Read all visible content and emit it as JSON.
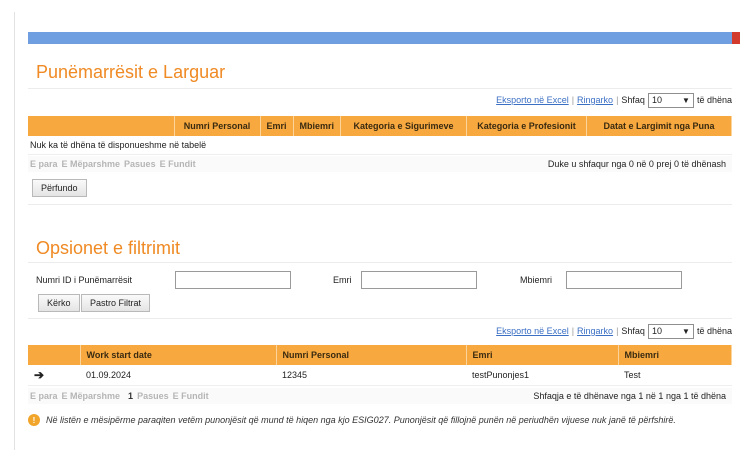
{
  "section1": {
    "title": "Punëmarrësit e Larguar",
    "toolbar": {
      "export": "Eksporto në Excel",
      "refresh": "Ringarko",
      "show": "Shfaq",
      "page_size": "10",
      "unit": "të dhëna"
    },
    "columns": [
      "",
      "Numri Personal",
      "Emri",
      "Mbiemri",
      "Kategoria e Sigurimeve",
      "Kategoria e Profesionit",
      "Datat e Largimit nga Puna"
    ],
    "empty_message": "Nuk ka të dhëna të disponueshme në tabelë",
    "pager": {
      "first": "E para",
      "prev": "E Mëparshme",
      "next": "Pasues",
      "last": "E Fundit",
      "info": "Duke u shfaqur nga 0 në 0 prej 0 të dhënash"
    },
    "finish_button": "Përfundo"
  },
  "section2": {
    "title": "Opsionet e filtrimit",
    "fields": {
      "id_label": "Numri ID i Punëmarrësit",
      "name_label": "Emri",
      "surname_label": "Mbiemri",
      "id_value": "",
      "name_value": "",
      "surname_value": ""
    },
    "search_button": "Kërko",
    "clear_button": "Pastro Filtrat",
    "toolbar": {
      "export": "Eksporto në Excel",
      "refresh": "Ringarko",
      "show": "Shfaq",
      "page_size": "10",
      "unit": "të dhëna"
    },
    "columns": [
      "",
      "Work start date",
      "Numri Personal",
      "Emri",
      "Mbiemri"
    ],
    "rows": [
      {
        "arrow": "➔",
        "date": "01.09.2024",
        "personal": "12345",
        "name": "testPunonjes1",
        "surname": "Test"
      }
    ],
    "pager": {
      "first": "E para",
      "prev": "E Mëparshme",
      "current": "1",
      "next": "Pasues",
      "last": "E Fundit",
      "info": "Shfaqja e të dhënave nga 1 në 1 nga 1 të dhëna"
    }
  },
  "note": "Në listën e mësipërme paraqiten vetëm punonjësit që mund të hiqen nga kjo ESIG027. Punonjësit që fillojnë punën në periudhën vijuese nuk janë të përfshirë.",
  "colors": {
    "accent": "#ef8a24",
    "header": "#f7a940",
    "topbar": "#6f9fe0",
    "link": "#3b6fc4"
  }
}
